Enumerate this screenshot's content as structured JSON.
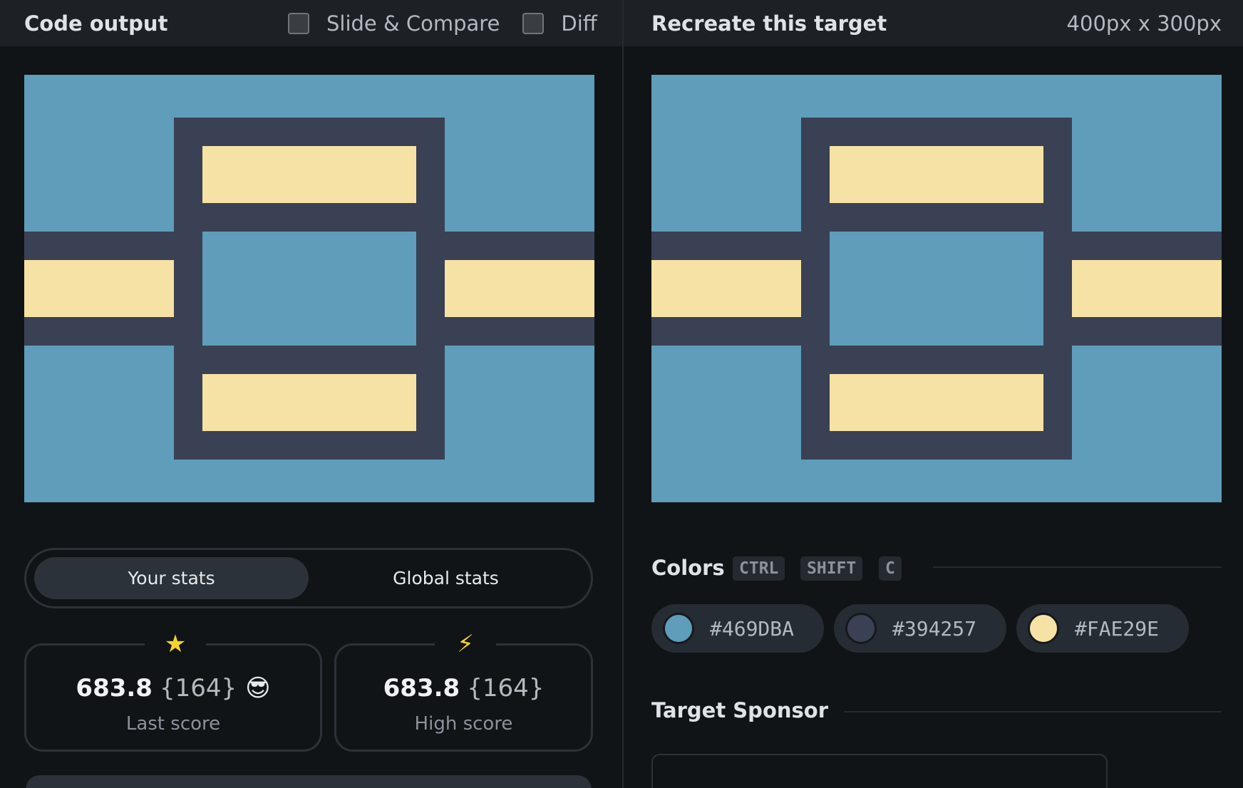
{
  "left_panel": {
    "title": "Code output",
    "options": [
      {
        "label": "Slide & Compare",
        "checked": false
      },
      {
        "label": "Diff",
        "checked": false
      }
    ]
  },
  "right_panel": {
    "title": "Recreate this target",
    "dimensions": "400px x 300px"
  },
  "stats": {
    "tabs": [
      "Your stats",
      "Global stats"
    ],
    "active_tab": "Your stats",
    "last": {
      "icon": "★",
      "score": "683.8",
      "count": "{164}",
      "emoji": "😎",
      "label": "Last score"
    },
    "high": {
      "icon": "⚡",
      "score": "683.8",
      "count": "{164}",
      "label": "High score"
    }
  },
  "colors": {
    "title": "Colors",
    "shortcut": [
      "CTRL",
      "SHIFT",
      "C"
    ],
    "swatches": [
      {
        "hex": "#469DBA",
        "color": "#5f9dba"
      },
      {
        "hex": "#394257",
        "color": "#3a4154"
      },
      {
        "hex": "#FAE29E",
        "color": "#f6e2a4"
      }
    ]
  },
  "sponsor": {
    "title": "Target Sponsor"
  }
}
